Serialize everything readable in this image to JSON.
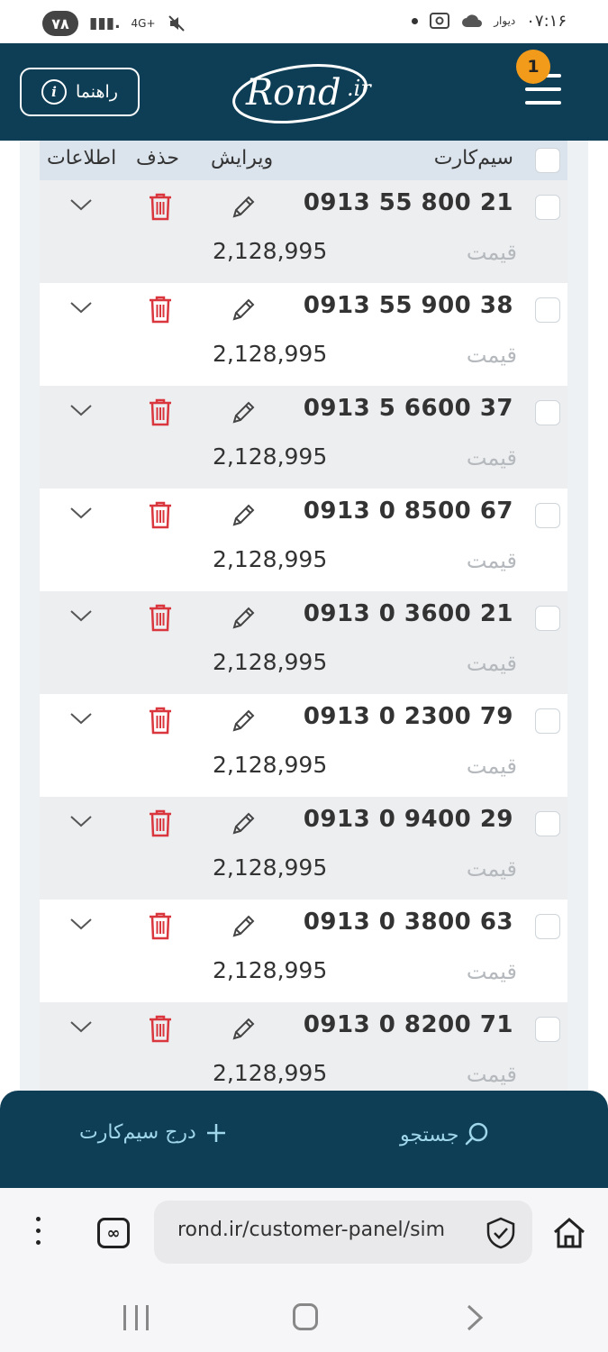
{
  "statusbar": {
    "battery": "۷۸",
    "network": "4G+",
    "time": "۰۷:۱۶",
    "app_label": "دیوار"
  },
  "header": {
    "help_label": "راهنما",
    "logo_text": "Rond",
    "logo_suffix": ".ir",
    "notification_count": "1"
  },
  "table": {
    "columns": {
      "simcard": "سیم‌کارت",
      "edit": "ویرایش",
      "delete": "حذف",
      "info": "اطلاعات"
    },
    "price_label": "قیمت",
    "rows": [
      {
        "number": "0913 55 800 21",
        "price": "2,128,995"
      },
      {
        "number": "0913 55 900 38",
        "price": "2,128,995"
      },
      {
        "number": "0913 5 6600 37",
        "price": "2,128,995"
      },
      {
        "number": "0913 0 8500 67",
        "price": "2,128,995"
      },
      {
        "number": "0913 0 3600 21",
        "price": "2,128,995"
      },
      {
        "number": "0913 0 2300 79",
        "price": "2,128,995"
      },
      {
        "number": "0913 0 9400 29",
        "price": "2,128,995"
      },
      {
        "number": "0913 0 3800 63",
        "price": "2,128,995"
      },
      {
        "number": "0913 0 8200 71",
        "price": "2,128,995"
      }
    ]
  },
  "bottom_bar": {
    "add_label": "درج سیم‌کارت",
    "search_label": "جستجو"
  },
  "browser": {
    "url": "rond.ir/customer-panel/sim"
  },
  "colors": {
    "header_bg": "#0e3e55",
    "badge": "#f29b1b",
    "delete_red": "#d9363e",
    "accent_text": "#9fd6ea"
  }
}
